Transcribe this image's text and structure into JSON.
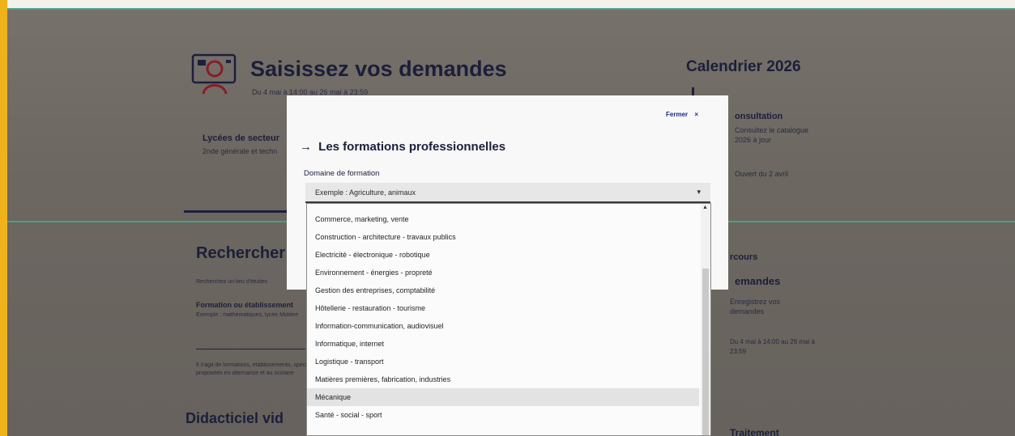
{
  "header": {
    "title": "Saisissez vos demandes",
    "subtitle": "Du 4 mai à 14:00 au 26 mai à 23:59"
  },
  "calendar": {
    "title": "Calendrier 2026",
    "consultation_label": "onsultation",
    "consultation_line1": "Consultez le catalogue",
    "consultation_line2": "2026 à jour",
    "consultation_line3": "Ouvert du 2 avril",
    "demandes_label": "emandes",
    "demandes_line1": "Enregistrez vos",
    "demandes_line2": "demandes",
    "demandes_line3": "Du 4 mai à 14:00 au 26 mai à",
    "demandes_line4": "23:59",
    "traitement_label": "Traitement",
    "parcours_label": "rcours"
  },
  "page": {
    "lycees_label": "Lycées de secteur",
    "lycees_sub": "2nde générale et techn",
    "search_heading": "Rechercher",
    "search_hint": "Recherchez un lieu d'études",
    "formation_label": "Formation ou établissement",
    "formation_hint": "Exemple : mathématiques, lycée Molière",
    "footnote1": "Il s'agit de formations, établissements, spécialités",
    "footnote2": "proposées en alternance et au scolaire",
    "didacticiel_heading": "Didacticiel vid"
  },
  "modal": {
    "close_label": "Fermer",
    "close_icon_glyph": "×",
    "arrow_glyph": "→",
    "title": "Les formations professionnelles",
    "field_label": "Domaine de formation",
    "placeholder": "Exemple : Agriculture, animaux",
    "chevron_glyph": "▾"
  },
  "dropdown": {
    "scroll_up_glyph": "▲",
    "highlighted_index": 10,
    "options": [
      "Commerce, marketing, vente",
      "Construction - architecture - travaux publics",
      "Electricité - électronique - robotique",
      "Environnement - énergies - propreté",
      "Gestion des entreprises, comptabilité",
      "Hôtellerie - restauration - tourisme",
      "Information-communication, audiovisuel",
      "Informatique, internet",
      "Logistique - transport",
      "Matières premières, fabrication, industries",
      "Mécanique",
      "Santé - social - sport"
    ]
  },
  "colors": {
    "navy": "#1c1f3d",
    "accent_blue": "#1c2d82",
    "screen_tint": "#6c6761",
    "scanline": "#39b99a",
    "photo_edge": "#f0b21a"
  }
}
